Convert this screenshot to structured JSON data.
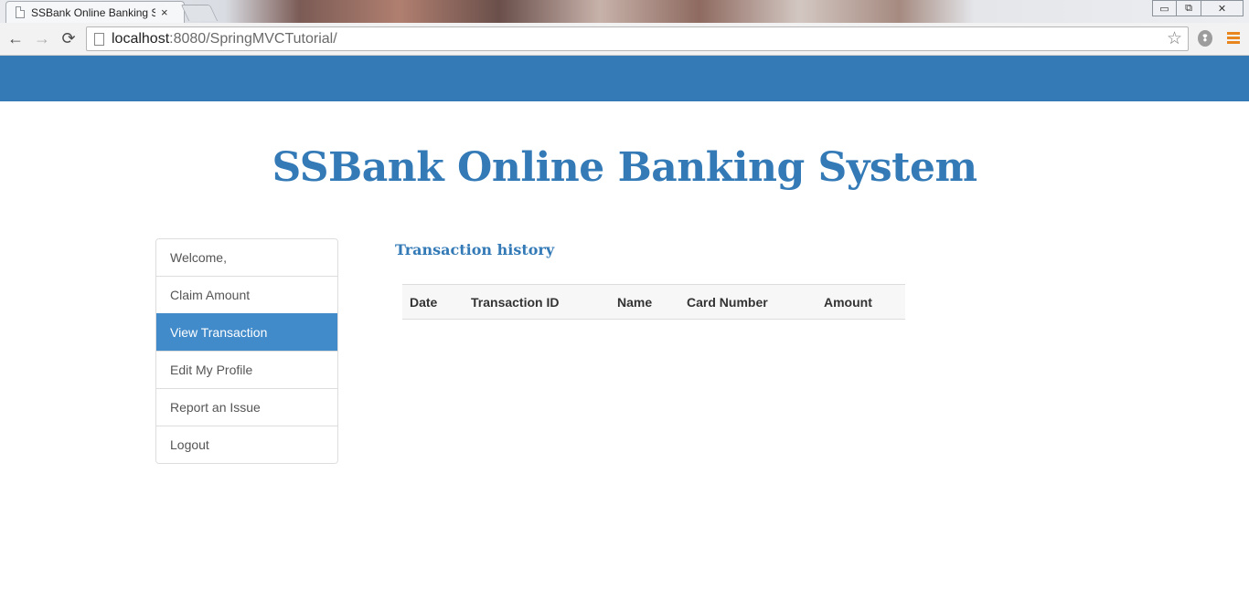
{
  "browser": {
    "tab_title": "SSBank Online Banking Sy",
    "tab_close": "×",
    "url_host": "localhost",
    "url_rest": ":8080/SpringMVCTutorial/",
    "window_controls": {
      "minimize": "▭",
      "restore": "⧉",
      "close": "✕"
    },
    "nav": {
      "back": "←",
      "forward": "→",
      "reload": "⟳"
    },
    "star": "☆",
    "ext_icon": "❢"
  },
  "colors": {
    "brand": "#337ab7",
    "active_item": "#428bca"
  },
  "page": {
    "title": "SSBank Online Banking System",
    "sidebar": {
      "items": [
        {
          "label": "Welcome,"
        },
        {
          "label": "Claim Amount"
        },
        {
          "label": "View Transaction",
          "active": true
        },
        {
          "label": "Edit My Profile"
        },
        {
          "label": "Report an Issue"
        },
        {
          "label": "Logout"
        }
      ]
    },
    "main": {
      "heading": "Transaction history",
      "table": {
        "columns": [
          "Date",
          "Transaction ID",
          "Name",
          "Card Number",
          "Amount"
        ],
        "rows": []
      }
    }
  }
}
